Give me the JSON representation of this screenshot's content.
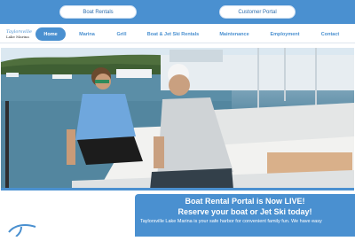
{
  "topbar": {
    "boat_rentals_label": "Boat Rentals",
    "customer_portal_label": "Customer Portal"
  },
  "logo": {
    "name": "Taylorsville",
    "tagline": "Lake Marina"
  },
  "nav": {
    "items": [
      {
        "label": "Home"
      },
      {
        "label": "Marina"
      },
      {
        "label": "Grill"
      },
      {
        "label": "Boat & Jet Ski Rentals"
      },
      {
        "label": "Maintenance"
      },
      {
        "label": "Employment"
      },
      {
        "label": "Contact"
      }
    ]
  },
  "promo": {
    "headline": "Boat Rental Portal is Now LIVE!",
    "subheadline": "Reserve your boat or Jet Ski today!",
    "body": "Taylorsville Lake Marina is your safe harbor for convenient family fun. We have easy"
  },
  "colors": {
    "brand_blue": "#4a90d0",
    "white": "#ffffff"
  }
}
